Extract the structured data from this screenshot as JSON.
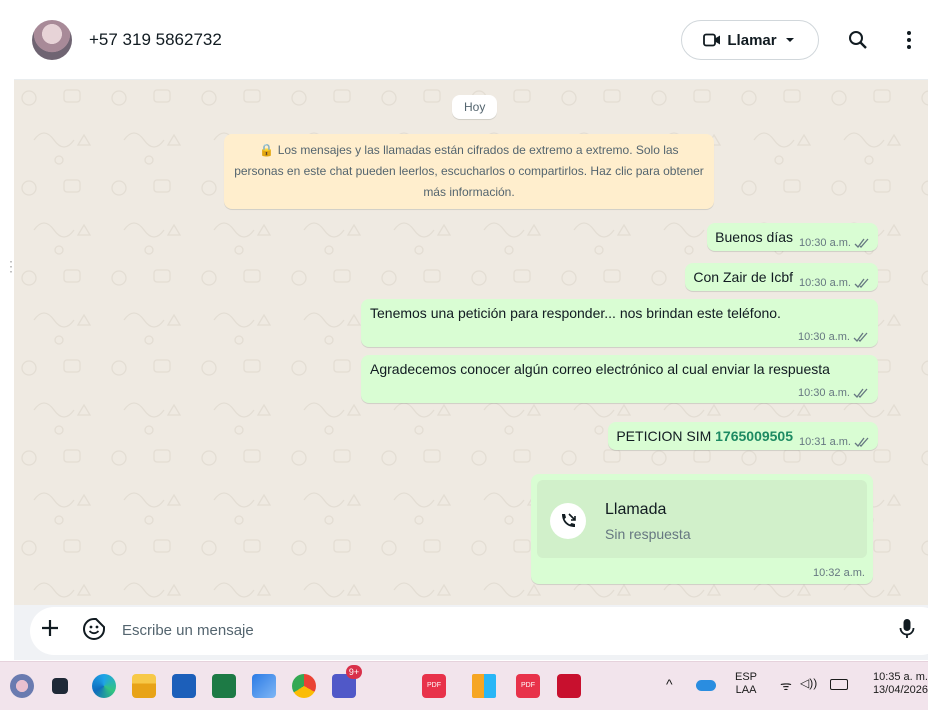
{
  "header": {
    "contact": "+57 319 5862732",
    "call_label": "Llamar"
  },
  "chat": {
    "date_pill": "Hoy",
    "encryption_notice": "🔒 Los mensajes y las llamadas están cifrados de extremo a extremo. Solo las personas en este chat pueden leerlos, escucharlos o compartirlos. Haz clic para obtener más información.",
    "messages": [
      {
        "text": "Buenos días",
        "time": "10:30 a.m."
      },
      {
        "text": "Con Zair de Icbf",
        "time": "10:30 a.m."
      },
      {
        "text": "Tenemos una petición para responder... nos brindan este teléfono.",
        "time": "10:30 a.m."
      },
      {
        "text": "Agradecemos conocer algún correo electrónico al cual enviar la respuesta",
        "time": "10:30 a.m."
      },
      {
        "text": "PETICION SIM ",
        "number": "1765009505",
        "time": "10:31 a.m."
      }
    ],
    "call": {
      "title": "Llamada",
      "subtitle": "Sin respuesta",
      "time": "10:32 a.m."
    }
  },
  "composer": {
    "placeholder": "Escribe un mensaje"
  },
  "taskbar": {
    "lang_top": "ESP",
    "lang_bottom": "LAA",
    "time": "10:35 a. m.",
    "date": "13/04/2026",
    "badge": "9+",
    "pdf_label": "PDF"
  },
  "colors": {
    "outgoing_bubble": "#d9fdd3",
    "chat_background": "#efeae2",
    "tick_color": "#667781",
    "number_link": "#1d8a62"
  }
}
